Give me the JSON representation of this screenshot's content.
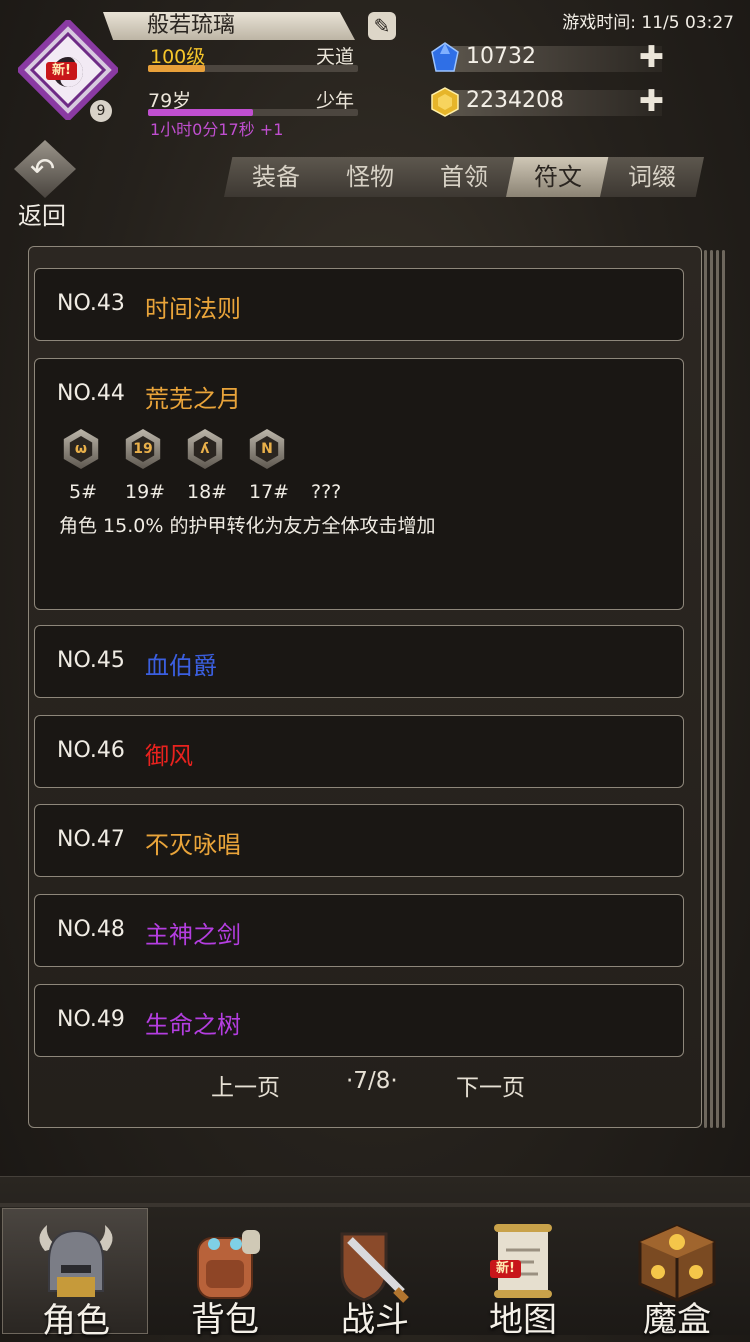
{
  "header": {
    "player_name": "般若琉璃",
    "level_text": "100级",
    "level_progress": 0.27,
    "realm": "天道",
    "age_text": "79岁",
    "age_stage": "少年",
    "age_progress": 0.5,
    "timer_text": "1小时0分17秒 +1",
    "avatar_badge_new": "新!",
    "avatar_level_badge": "9",
    "game_time": "游戏时间: 11/5 03:27",
    "gems": "10732",
    "gold": "2234208"
  },
  "back_label": "返回",
  "tabs": [
    {
      "label": "装备",
      "active": false
    },
    {
      "label": "怪物",
      "active": false
    },
    {
      "label": "首领",
      "active": false
    },
    {
      "label": "符文",
      "active": true
    },
    {
      "label": "词缀",
      "active": false
    }
  ],
  "entries": [
    {
      "no": "NO.43",
      "name": "时间法则",
      "color": "#e9a43a"
    },
    {
      "no": "NO.44",
      "name": "荒芜之月",
      "color": "#e9a43a"
    },
    {
      "no": "NO.45",
      "name": "血伯爵",
      "color": "#3b5fe0"
    },
    {
      "no": "NO.46",
      "name": "御风",
      "color": "#e8221e"
    },
    {
      "no": "NO.47",
      "name": "不灭咏唱",
      "color": "#e9a43a"
    },
    {
      "no": "NO.48",
      "name": "主神之剑",
      "color": "#b43ee0"
    },
    {
      "no": "NO.49",
      "name": "生命之树",
      "color": "#b43ee0"
    }
  ],
  "expanded": {
    "runes": [
      {
        "glyph": "ω",
        "label": "5#"
      },
      {
        "glyph": "19",
        "label": "19#"
      },
      {
        "glyph": "ʎ",
        "label": "18#"
      },
      {
        "glyph": "N",
        "label": "17#"
      }
    ],
    "unknown_label": "???",
    "description": "角色 15.0% 的护甲转化为友方全体攻击增加"
  },
  "pager": {
    "prev": "上一页",
    "page": "·7/8·",
    "next": "下一页"
  },
  "nav": [
    {
      "label": "角色",
      "active": true
    },
    {
      "label": "背包",
      "active": false
    },
    {
      "label": "战斗",
      "active": false
    },
    {
      "label": "地图",
      "active": false,
      "badge": "新!"
    },
    {
      "label": "魔盒",
      "active": false
    }
  ],
  "icons": [
    "helmet-icon",
    "backpack-icon",
    "sword-shield-icon",
    "map-scroll-icon",
    "magic-box-icon",
    "gem-icon",
    "gold-icon",
    "edit-icon",
    "plus-icon",
    "back-arrow-icon"
  ]
}
